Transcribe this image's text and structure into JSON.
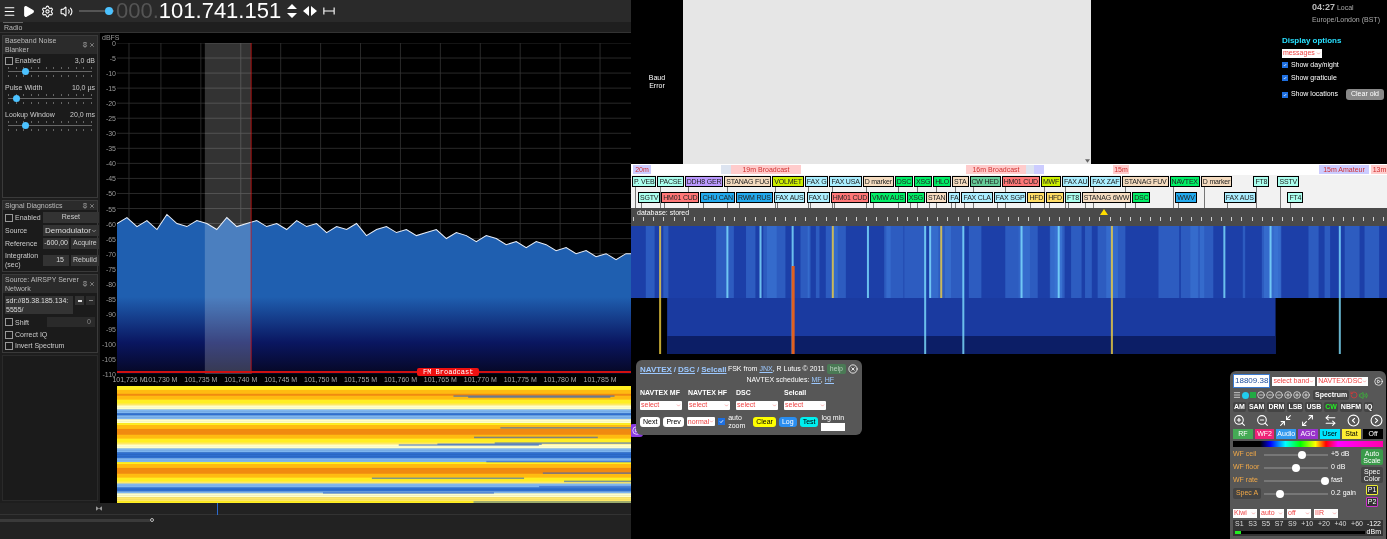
{
  "toolbar": {
    "volume": {
      "level": 0.85
    },
    "frequency_prefix": "000.",
    "frequency": "101.741.151"
  },
  "sidebar": {
    "tab": "Radio",
    "noise_blanker": {
      "title": "Baseband Noise Blanker",
      "enabled_label": "Enabled",
      "enabled": false,
      "threshold": "3,0 dB",
      "threshold_level": {
        "level": 0.2
      },
      "pulse_label": "Pulse Width",
      "pulse": "10,0 µs",
      "pulse_level": {
        "level": 0.1
      },
      "lookup_label": "Lookup Window",
      "lookup": "20,0 ms",
      "lookup_level": {
        "level": 0.2
      }
    },
    "diagnostics": {
      "title": "Signal Diagnostics",
      "enabled_label": "Enabled",
      "enabled": false,
      "reset": "Reset",
      "source_label": "Source",
      "source": "Demodulator",
      "reference_label": "Reference",
      "reference": "-600,00",
      "acquire": "Acquire",
      "integration_label": "Integration (sec)",
      "integration": "15",
      "rebuild": "Rebuild"
    },
    "source": {
      "title": "Source: AIRSPY Server Network",
      "address": "sdr://85.38.185.134:5555/",
      "shift_label": "Shift",
      "shift": false,
      "shift_value": "0",
      "correct_iq_label": "Correct IQ",
      "correct_iq": false,
      "invert_label": "Invert Spectrum",
      "invert": false
    }
  },
  "spectrum": {
    "band_label": "FM Broadcast",
    "chart_data": {
      "type": "area",
      "ylabel": "dBFS",
      "xlim": [
        101724.5,
        101789
      ],
      "ylim": [
        -110,
        0
      ],
      "grid": true,
      "bands": [
        {
          "axis": "x",
          "from": 101735.5,
          "to": 101741.3,
          "color": "#ffffff"
        }
      ],
      "ref_lines": [
        {
          "axis": "x",
          "value": 101741.3,
          "color": "#d01010"
        }
      ],
      "yticks": [
        0,
        -5,
        -10,
        -15,
        -20,
        -25,
        -30,
        -35,
        -40,
        -45,
        -50,
        -55,
        -60,
        -65,
        -70,
        -75,
        -80,
        -85,
        -90,
        -95,
        -100,
        -105,
        -110
      ],
      "xticks": [
        {
          "value": 101726,
          "label": "101,726 M"
        },
        {
          "value": 101730,
          "label": "101,730 M"
        },
        {
          "value": 101735,
          "label": "101,735 M"
        },
        {
          "value": 101740,
          "label": "101,740 M"
        },
        {
          "value": 101745,
          "label": "101,745 M"
        },
        {
          "value": 101750,
          "label": "101,750 M"
        },
        {
          "value": 101755,
          "label": "101,755 M"
        },
        {
          "value": 101760,
          "label": "101,760 M"
        },
        {
          "value": 101765,
          "label": "101,765 M"
        },
        {
          "value": 101770,
          "label": "101,770 M"
        },
        {
          "value": 101775,
          "label": "101,775 M"
        },
        {
          "value": 101780,
          "label": "101,780 M"
        },
        {
          "value": 101785,
          "label": "101,785 M"
        }
      ],
      "x": [
        101724.5,
        101725.75,
        101727,
        101728.25,
        101729.5,
        101730.75,
        101732,
        101733.25,
        101734.5,
        101735.75,
        101737,
        101738.25,
        101739.5,
        101740.75,
        101742,
        101743.25,
        101744.5,
        101745.75,
        101747,
        101748.25,
        101749.5,
        101750.75,
        101752,
        101753.25,
        101754.5,
        101755.75,
        101757,
        101758.25,
        101759.5,
        101760.75,
        101762,
        101763.25,
        101764.5,
        101765.75,
        101767,
        101768.25,
        101769.5,
        101770.75,
        101772,
        101773.25,
        101774.5,
        101775.75,
        101777,
        101778.25,
        101779.5,
        101780.75,
        101782,
        101783.25,
        101784.5,
        101785.75,
        101787,
        101788.25
      ],
      "series": [
        {
          "color": "#e8eef8",
          "values": [
            -60,
            -58,
            -61,
            -59,
            -62,
            -57,
            -60,
            -61,
            -59,
            -60,
            -62,
            -58,
            -61,
            -60,
            -59,
            -61,
            -60,
            -62,
            -59,
            -61,
            -60,
            -63,
            -61,
            -62,
            -60,
            -64,
            -62,
            -61,
            -63,
            -62,
            -64,
            -63,
            -62,
            -65,
            -63,
            -64,
            -66,
            -64,
            -65,
            -67,
            -66,
            -68,
            -66,
            -67,
            -69,
            -68,
            -70,
            -69,
            -71,
            -70,
            -72,
            -70
          ]
        }
      ]
    }
  },
  "decoder_status": "Baud Error",
  "clock": {
    "time": "04:27",
    "zone_label": "Local",
    "timezone": "Europe/London (BST)"
  },
  "display_options": {
    "title": "Display options",
    "select": "messages",
    "options": [
      {
        "label": "Show day/night",
        "checked": true
      },
      {
        "label": "Show graticule",
        "checked": true
      },
      {
        "label": "Show locations",
        "checked": true
      }
    ],
    "clear": "Clear old"
  },
  "bands": [
    {
      "label": "20m",
      "color": "#ccccff"
    },
    {
      "color": "#dde4f0"
    },
    {
      "label": "19m Broadcast",
      "color": "#ffcccc"
    },
    {
      "label": "16m Broadcast",
      "color": "#ffcccc"
    },
    {
      "color": "#dde4f0"
    },
    {
      "color": "#ccccff"
    },
    {
      "label": "15m",
      "color": "#ffcccc"
    },
    {
      "label": "15m Amateur",
      "color": "#ccccff"
    },
    {
      "label": "13m",
      "color": "#ffcccc"
    }
  ],
  "stations_row_1": [
    {
      "label": "P. VEB",
      "color": "#aaffee"
    },
    {
      "label": "PACSE",
      "color": "#aaffee"
    },
    {
      "label": "DDH8 GER",
      "color": "#bb99ff"
    },
    {
      "label": "STANAG FUG",
      "color": "#f5dcc0"
    },
    {
      "label": "VOLMET",
      "color": "#ccee00"
    },
    {
      "label": "FAX G",
      "color": "#aaeeff"
    },
    {
      "label": "FAX USA",
      "color": "#aaeeff"
    },
    {
      "label": "D marker",
      "color": "#f5dcc0"
    },
    {
      "label": "DSC",
      "color": "#00ee66"
    },
    {
      "label": "XSG",
      "color": "#00ee66"
    },
    {
      "label": "HLO",
      "color": "#00ee66"
    },
    {
      "label": "STA",
      "color": "#f5dcc0"
    },
    {
      "label": "CW HED",
      "color": "#66cc99"
    },
    {
      "label": "HM01 CUD",
      "color": "#ff7777"
    },
    {
      "label": "MWF",
      "color": "#ccee00"
    },
    {
      "label": "FAX AU",
      "color": "#aaeeff"
    },
    {
      "label": "FAX ZAF",
      "color": "#aaeeff"
    },
    {
      "label": "STANAG FUV",
      "color": "#f5dcc0"
    },
    {
      "label": "NAVTEX",
      "color": "#00ee66"
    },
    {
      "label": "D marker",
      "color": "#f5dcc0"
    },
    {
      "label": "FT8",
      "color": "#aaffee"
    },
    {
      "label": "SSTV",
      "color": "#aaffee"
    }
  ],
  "stations_row_2": [
    {
      "label": "SGTV",
      "color": "#aaffee"
    },
    {
      "label": "HM01 CUD",
      "color": "#ff7777"
    },
    {
      "label": "CHU CAN",
      "color": "#22aaee"
    },
    {
      "label": "RWM RUS",
      "color": "#22aaee"
    },
    {
      "label": "FAX AUS",
      "color": "#aaeeff"
    },
    {
      "label": "FAX U",
      "color": "#aaeeff"
    },
    {
      "label": "HM01 CUD",
      "color": "#ff7777"
    },
    {
      "label": "VMW AUS",
      "color": "#00ee66"
    },
    {
      "label": "XSG",
      "color": "#00ee66"
    },
    {
      "label": "STAN",
      "color": "#f5dcc0"
    },
    {
      "label": "FA",
      "color": "#aaeeff"
    },
    {
      "label": "FAX CLA",
      "color": "#aaeeff"
    },
    {
      "label": "FAX SGP",
      "color": "#aaeeff"
    },
    {
      "label": "HFD",
      "color": "#ffdd66"
    },
    {
      "label": "HFD",
      "color": "#ffdd66"
    },
    {
      "label": "FT8",
      "color": "#aaffee"
    },
    {
      "label": "STANAG 6WW",
      "color": "#f5dcc0"
    },
    {
      "label": "DSC",
      "color": "#00ee66"
    },
    {
      "label": "WWV",
      "color": "#22aaee"
    },
    {
      "label": "FAX AUS",
      "color": "#aaeeff"
    },
    {
      "label": "FT4",
      "color": "#aaffee"
    }
  ],
  "database_label": "database: stored",
  "navtex": {
    "tabs": [
      {
        "label": "NAVTEX"
      },
      {
        "label": "DSC"
      },
      {
        "label": "Selcall"
      }
    ],
    "separator": "/",
    "credit_prefix": "FSK from",
    "credit_link": "JNX",
    "credit_suffix": ", R Lutus © 2011",
    "help": "help",
    "schedules_label": "NAVTEX schedules:",
    "schedule_links": [
      "MF",
      "HF"
    ],
    "schedule_separator": ",",
    "menus": [
      {
        "label": "NAVTEX MF",
        "value": "select"
      },
      {
        "label": "NAVTEX HF",
        "value": "select"
      },
      {
        "label": "DSC",
        "value": "select"
      },
      {
        "label": "Selcall",
        "value": "select"
      }
    ],
    "next": "Next",
    "prev": "Prev",
    "mode": "normal",
    "auto_zoom_label": "auto zoom",
    "auto_zoom": true,
    "clear": "Clear",
    "log": "Log",
    "test": "Test",
    "log_min_label": "log min"
  },
  "control_panel": {
    "frequency": "18809.38",
    "band_select": "select band",
    "extension_select": "NAVTEX/DSC",
    "spectrum_button": "Spectrum",
    "modes": [
      {
        "label": "AM",
        "selected": false
      },
      {
        "label": "SAM",
        "selected": false
      },
      {
        "label": "DRM",
        "selected": false
      },
      {
        "label": "LSB",
        "selected": false
      },
      {
        "label": "USB",
        "selected": false
      },
      {
        "label": "CW",
        "selected": true
      },
      {
        "label": "NBFM",
        "selected": false
      },
      {
        "label": "IQ",
        "selected": false
      }
    ],
    "tabs": [
      {
        "label": "RF",
        "color": "#44aa55"
      },
      {
        "label": "WF2",
        "color": "#ee2277"
      },
      {
        "label": "Audio",
        "color": "#3399ee"
      },
      {
        "label": "AGC",
        "color": "#9933cc"
      },
      {
        "label": "User",
        "color": "#00e5ff"
      },
      {
        "label": "Stat",
        "color": "#ffee33"
      },
      {
        "label": "Off",
        "color": "#000000"
      }
    ],
    "sliders": [
      {
        "kind": "label",
        "label": "WF ceil",
        "level": 0.6,
        "reading": "+5 dB"
      },
      {
        "kind": "label",
        "label": "WF floor",
        "level": 0.5,
        "reading": "0 dB"
      },
      {
        "kind": "label",
        "label": "WF rate",
        "level": 0.95,
        "reading": "fast"
      },
      {
        "kind": "button",
        "label": "Spec A",
        "level": 0.25,
        "reading": "0.2 gain"
      }
    ],
    "side_buttons": [
      "Auto Scale",
      "Spec Color",
      "P1",
      "P2"
    ],
    "selects": [
      "Kiwi",
      "auto",
      "off",
      "IIR"
    ],
    "s_meter": {
      "ticks": [
        "S1",
        "S3",
        "S5",
        "S7",
        "S9",
        "+10",
        "+20",
        "+40",
        "+60"
      ],
      "level": 0.05,
      "reading": "-122",
      "unit": "dBm"
    }
  }
}
